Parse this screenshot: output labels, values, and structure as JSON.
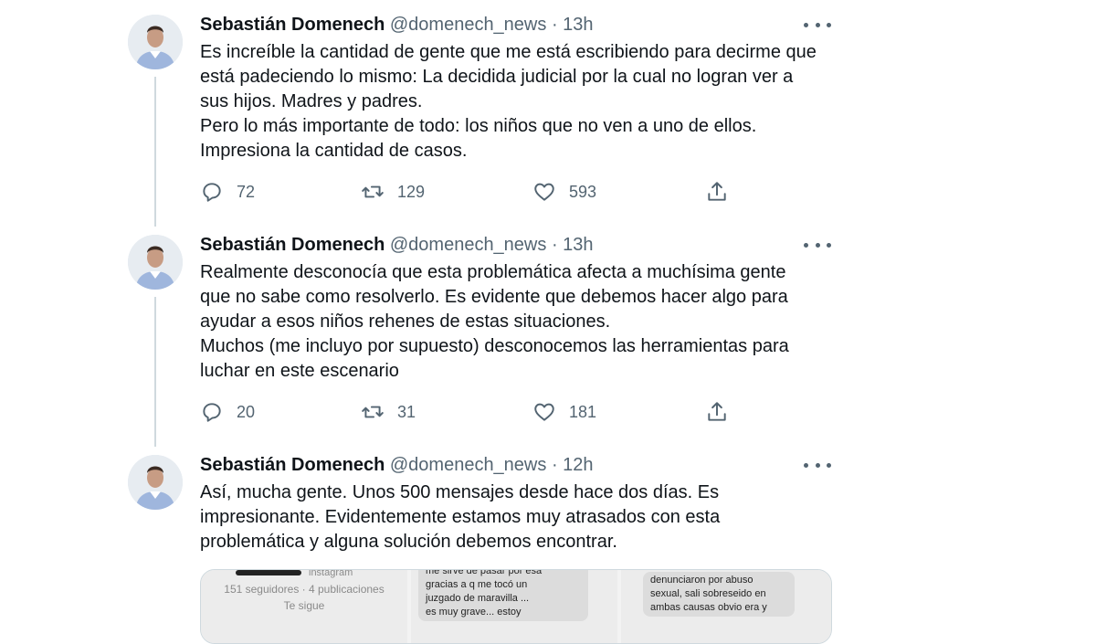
{
  "tweets": [
    {
      "name": "Sebastián Domenech",
      "handle": "@domenech_news",
      "sep": "·",
      "time": "13h",
      "text": [
        "Es increíble la cantidad de gente que me está escribiendo para decirme que está padeciendo lo mismo: La decidida judicial por la cual no logran ver a sus hijos. Madres y padres.",
        "Pero lo más importante de todo: los niños que no ven a uno de ellos. Impresiona la cantidad de casos."
      ],
      "replies": "72",
      "retweets": "129",
      "likes": "593"
    },
    {
      "name": "Sebastián Domenech",
      "handle": "@domenech_news",
      "sep": "·",
      "time": "13h",
      "text": [
        "Realmente desconocía que esta problemática afecta a muchísima gente que no sabe como resolverlo. Es evidente que debemos hacer algo para ayudar a esos niños rehenes de estas situaciones.",
        "Muchos (me incluyo por supuesto) desconocemos las herramientas para luchar en este escenario"
      ],
      "replies": "20",
      "retweets": "31",
      "likes": "181"
    },
    {
      "name": "Sebastián Domenech",
      "handle": "@domenech_news",
      "sep": "·",
      "time": "12h",
      "text": [
        "Así, mucha gente. Unos 500 mensajes desde hace dos días. Es impresionante. Evidentemente estamos muy atrasados con esta problemática y alguna solución debemos encontrar."
      ]
    }
  ],
  "media": {
    "shot1": {
      "line1": "instagram",
      "line2": "151 seguidores · 4 publicaciones",
      "line3": "Te sigue"
    },
    "shot2": {
      "line1": "me sirve de pasar por esa",
      "line2": "gracias a q me tocó un",
      "line3": "juzgado de maravilla ...",
      "line4": "es muy grave... estoy"
    },
    "shot3": {
      "line1": "denunciaron por abuso",
      "line2": "sexual, sali sobreseido en",
      "line3": "ambas causas obvio era y"
    }
  },
  "icons": {
    "reply": "reply-icon",
    "retweet": "retweet-icon",
    "like": "heart-icon",
    "share": "share-icon",
    "more": "more-icon"
  },
  "colors": {
    "text": "#0f1419",
    "secondary": "#536471",
    "thread_line": "#cfd9de"
  }
}
